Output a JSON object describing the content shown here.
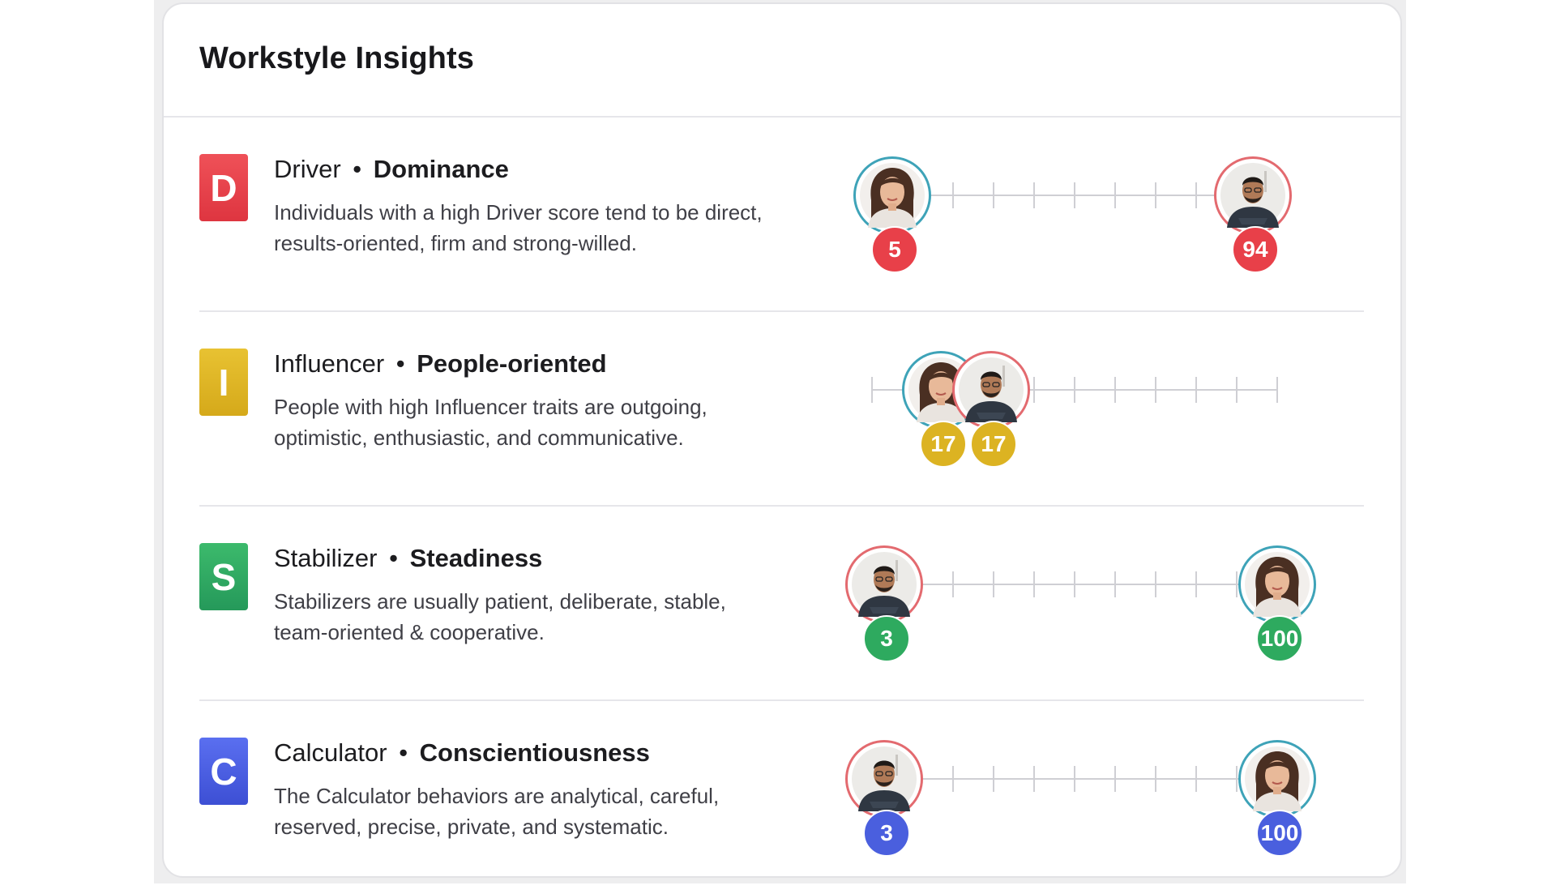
{
  "card": {
    "title": "Workstyle Insights"
  },
  "colors": {
    "driver": "#e84049",
    "influencer": "#dcb322",
    "stabilizer": "#2eaa5f",
    "calculator": "#4a5fde",
    "ring_woman": "#3ea3b8",
    "ring_man": "#e36a6f"
  },
  "rows": [
    {
      "letter": "D",
      "name": "Driver",
      "separator": "•",
      "trait": "Dominance",
      "description": "Individuals with a high Driver score tend to be direct, results-oriented, firm and strong-willed.",
      "people": [
        {
          "avatar": "woman-avatar-icon",
          "score": "5",
          "value": 5
        },
        {
          "avatar": "man-avatar-icon",
          "score": "94",
          "value": 94
        }
      ]
    },
    {
      "letter": "I",
      "name": "Influencer",
      "separator": "•",
      "trait": "People-oriented",
      "description": "People with high Influencer traits are outgoing, optimistic, enthusiastic, and communicative.",
      "people": [
        {
          "avatar": "woman-avatar-icon",
          "score": "17",
          "value": 17
        },
        {
          "avatar": "man-avatar-icon",
          "score": "17",
          "value": 17
        }
      ]
    },
    {
      "letter": "S",
      "name": "Stabilizer",
      "separator": "•",
      "trait": "Steadiness",
      "description": "Stabilizers are usually patient, deliberate, stable, team-oriented & cooperative.",
      "people": [
        {
          "avatar": "man-avatar-icon",
          "score": "3",
          "value": 3
        },
        {
          "avatar": "woman-avatar-icon",
          "score": "100",
          "value": 100
        }
      ]
    },
    {
      "letter": "C",
      "name": "Calculator",
      "separator": "•",
      "trait": "Conscientiousness",
      "description": "The Calculator behaviors are analytical, careful, reserved, precise, private, and systematic.",
      "people": [
        {
          "avatar": "man-avatar-icon",
          "score": "3",
          "value": 3
        },
        {
          "avatar": "woman-avatar-icon",
          "score": "100",
          "value": 100
        }
      ]
    }
  ]
}
